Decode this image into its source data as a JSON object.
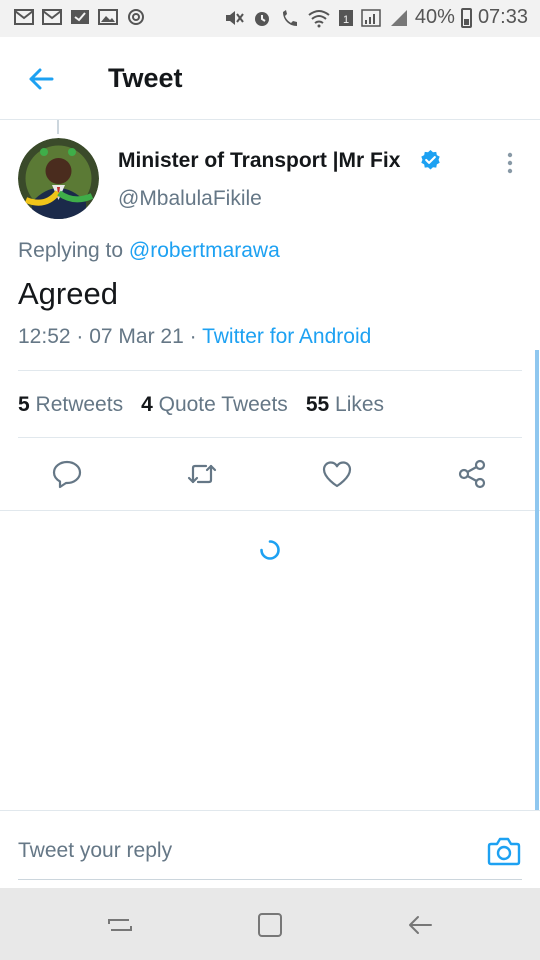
{
  "status_bar": {
    "left_icons": [
      "gmail-icon",
      "gmail-icon",
      "inbox-icon",
      "gallery-icon",
      "sync-icon"
    ],
    "right_icons": [
      "mute-icon",
      "alarm-icon",
      "wifi-call-icon",
      "wifi-icon",
      "sim-icon",
      "signal-icon",
      "battery-icon"
    ],
    "battery": "40%",
    "time": "07:33"
  },
  "header": {
    "title": "Tweet",
    "back_icon": "arrow-left-icon"
  },
  "tweet": {
    "author_name": "Minister of Transport |Mr Fix",
    "handle": "@MbalulaFikile",
    "replying_prefix": "Replying to ",
    "replying_to": "@robertmarawa",
    "text": "Agreed",
    "time": "12:52 · 07 Mar 21 · ",
    "source": "Twitter for Android"
  },
  "stats": {
    "retweets_count": "5",
    "retweets_label": "Retweets",
    "quotes_count": "4",
    "quotes_label": "Quote Tweets",
    "likes_count": "55",
    "likes_label": "Likes"
  },
  "actions": [
    "reply-icon",
    "retweet-icon",
    "like-icon",
    "share-icon"
  ],
  "composer": {
    "placeholder": "Tweet your reply",
    "camera_icon": "camera-icon"
  },
  "nav_bar": [
    "recent-apps-icon",
    "home-icon",
    "back-icon"
  ],
  "colors": {
    "accent": "#1da1f2",
    "text_primary": "#14171a",
    "text_secondary": "#657786",
    "divider": "#e1e8ed"
  }
}
